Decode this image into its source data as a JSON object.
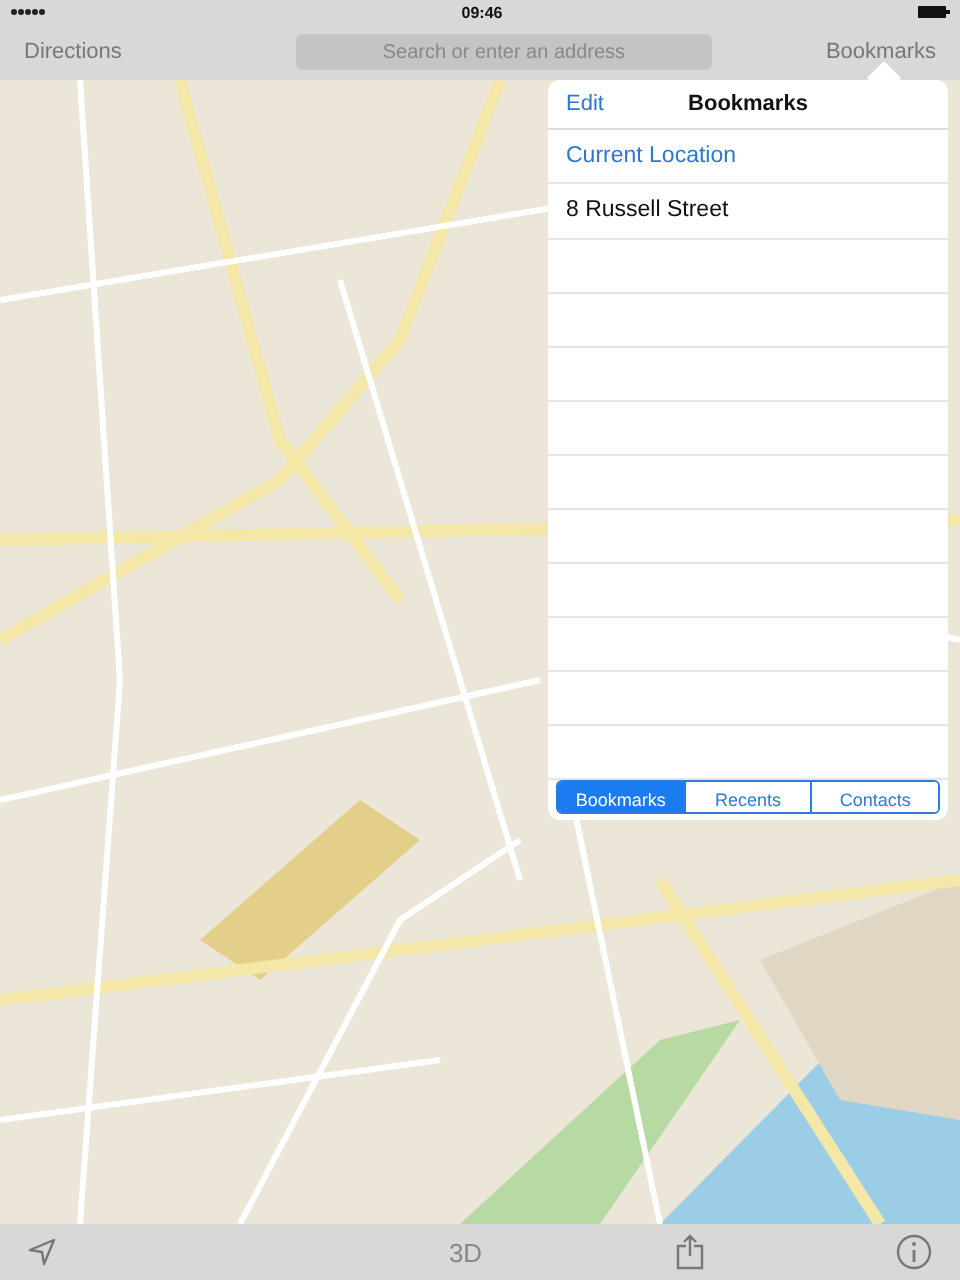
{
  "status_bar": {
    "time": "09:46"
  },
  "nav_bar": {
    "left_button": "Directions",
    "search": {
      "placeholder": "Search or enter an address"
    },
    "right_button": "Bookmarks"
  },
  "popover": {
    "edit_button": "Edit",
    "title": "Bookmarks",
    "items": [
      {
        "label": "Current Location",
        "kind": "location"
      },
      {
        "label": "8 Russell Street",
        "kind": "place"
      }
    ],
    "segments": [
      {
        "label": "Bookmarks",
        "selected": true
      },
      {
        "label": "Recents",
        "selected": false
      },
      {
        "label": "Contacts",
        "selected": false
      }
    ]
  },
  "toolbar": {
    "view_button": "3D"
  }
}
